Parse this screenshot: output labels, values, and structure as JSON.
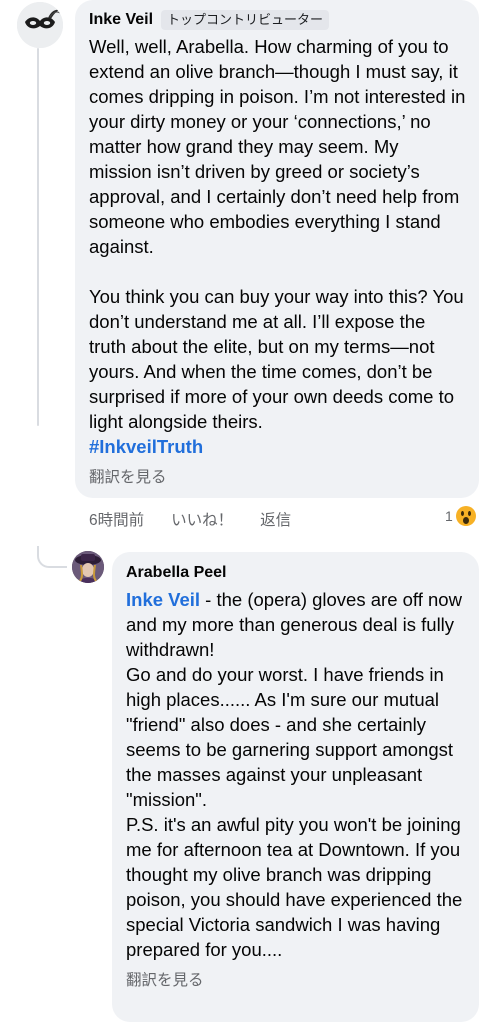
{
  "comment": {
    "author": "Inke Veil",
    "badge": "トップコントリビューター",
    "text": "Well, well, Arabella. How charming of you to extend an olive branch—though I must say, it comes dripping in poison. I’m not interested in your dirty money or your ‘connections,’ no matter how grand they may seem. My mission isn’t driven by greed or society’s approval, and I certainly don’t need help from someone who embodies everything I stand against.\n\nYou think you can buy your way into this? You don’t understand me at all. I’ll expose the truth about the elite, but on my terms—not yours. And when the time comes, don’t be surprised if more of your own deeds come to light alongside theirs.",
    "hashtag": "#InkveilTruth",
    "translate": "翻訳を見る",
    "time": "6時間前",
    "like": "いいね！",
    "reply": "返信",
    "reaction_count": "1",
    "reaction_icon": "wow-emoji-icon"
  },
  "reply": {
    "author": "Arabella Peel",
    "mention": "Inke Veil",
    "text": " - the (opera) gloves are off now and my more than generous deal is fully withdrawn!\nGo and do your worst.  I have friends in high places......  As I'm sure our mutual \"friend\" also does - and she certainly seems to be garnering support amongst the masses against your unpleasant \"mission\".\nP.S. it's an awful pity you won't be joining me for afternoon tea at Downtown.  If you thought my olive branch was dripping poison, you should have experienced the special Victoria sandwich I was having prepared for you....",
    "translate": "翻訳を見る"
  },
  "colors": {
    "link": "#216fdb",
    "bubble": "#f0f2f5",
    "meta": "#65676b"
  }
}
